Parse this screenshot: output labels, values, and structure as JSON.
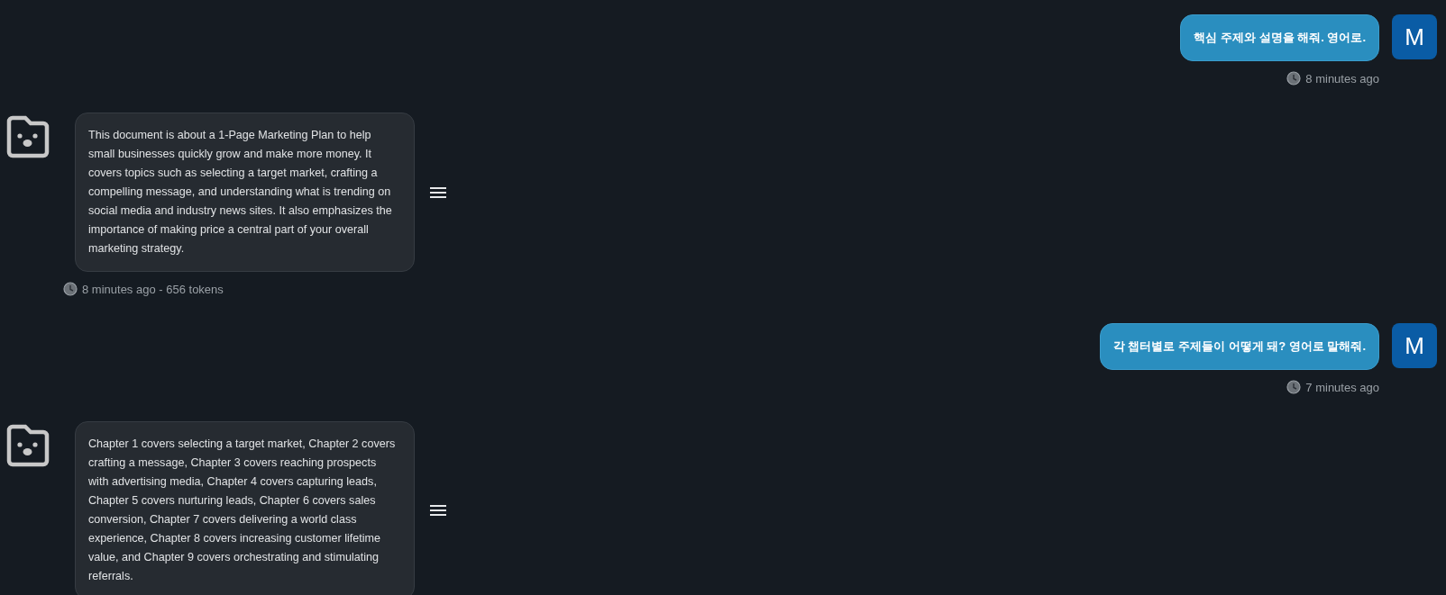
{
  "messages": [
    {
      "kind": "user",
      "text": "핵심 주제와 설명을 해줘. 영어로.",
      "avatar": "M",
      "meta": "8 minutes ago"
    },
    {
      "kind": "bot",
      "text": "This document is about a 1-Page Marketing Plan to help small businesses quickly grow and make more money. It covers topics such as selecting a target market, crafting a compelling message, and understanding what is trending on social media and industry news sites. It also emphasizes the importance of making price a central part of your overall marketing strategy.",
      "meta": "8 minutes ago - 656 tokens"
    },
    {
      "kind": "user",
      "text": "각 챕터별로 주제들이 어떻게 돼? 영어로 말해줘.",
      "avatar": "M",
      "meta": "7 minutes ago"
    },
    {
      "kind": "bot",
      "text": "Chapter 1 covers selecting a target market, Chapter 2 covers crafting a message, Chapter 3 covers reaching prospects with advertising media, Chapter 4 covers capturing leads, Chapter 5 covers nurturing leads, Chapter 6 covers sales conversion, Chapter 7 covers delivering a world class experience, Chapter 8 covers increasing customer lifetime value, and Chapter 9 covers orchestrating and stimulating referrals."
    }
  ]
}
